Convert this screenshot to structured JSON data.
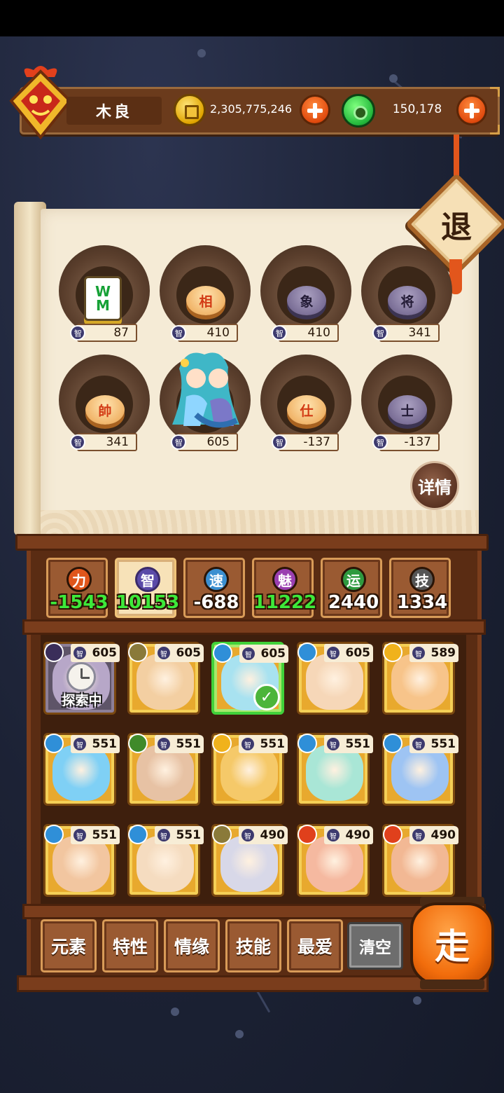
{
  "header": {
    "player_name": "木良",
    "gold": "2,305,775,246",
    "jade": "150,178",
    "avatar_icon": "demon-mask-icon",
    "gold_icon": "gold-coin-icon",
    "jade_icon": "jade-coin-icon"
  },
  "exit_label": "退",
  "details_label": "详情",
  "formation": {
    "stat_symbol": "智",
    "slots": [
      {
        "piece": "mahjong",
        "piece_text": "",
        "value": "87"
      },
      {
        "piece": "red-chess",
        "piece_text": "相",
        "value": "410"
      },
      {
        "piece": "purple-chess",
        "piece_text": "象",
        "value": "410"
      },
      {
        "piece": "purple-chess",
        "piece_text": "将",
        "value": "341"
      },
      {
        "piece": "red-chess",
        "piece_text": "帥",
        "value": "341"
      },
      {
        "piece": "hero",
        "piece_text": "",
        "value": "605"
      },
      {
        "piece": "red-chess",
        "piece_text": "仕",
        "value": "-137"
      },
      {
        "piece": "purple-chess",
        "piece_text": "士",
        "value": "-137"
      }
    ]
  },
  "attributes": [
    {
      "label": "力",
      "value": "-1543",
      "green": true,
      "active": false,
      "color": "#e0561c"
    },
    {
      "label": "智",
      "value": "10153",
      "green": true,
      "active": true,
      "color": "#5a4aa8"
    },
    {
      "label": "速",
      "value": "-688",
      "green": false,
      "active": false,
      "color": "#3b8fd0"
    },
    {
      "label": "魅",
      "value": "11222",
      "green": true,
      "active": false,
      "color": "#9a3fb0"
    },
    {
      "label": "运",
      "value": "2440",
      "green": false,
      "active": false,
      "color": "#2f9a3f"
    },
    {
      "label": "技",
      "value": "1334",
      "green": false,
      "active": false,
      "color": "#555555"
    }
  ],
  "heroes": [
    {
      "element": "dark",
      "value": "605",
      "status": "探索中",
      "state": "exploring"
    },
    {
      "element": "earth",
      "value": "605",
      "status": "",
      "state": "normal"
    },
    {
      "element": "water",
      "value": "605",
      "status": "",
      "state": "selected"
    },
    {
      "element": "water",
      "value": "605",
      "status": "",
      "state": "normal"
    },
    {
      "element": "light",
      "value": "589",
      "status": "",
      "state": "normal"
    },
    {
      "element": "water",
      "value": "551",
      "status": "",
      "state": "normal"
    },
    {
      "element": "wood",
      "value": "551",
      "status": "",
      "state": "normal"
    },
    {
      "element": "light",
      "value": "551",
      "status": "",
      "state": "normal"
    },
    {
      "element": "water",
      "value": "551",
      "status": "",
      "state": "normal"
    },
    {
      "element": "water",
      "value": "551",
      "status": "",
      "state": "normal"
    },
    {
      "element": "water",
      "value": "551",
      "status": "",
      "state": "normal"
    },
    {
      "element": "water",
      "value": "551",
      "status": "",
      "state": "normal"
    },
    {
      "element": "earth",
      "value": "490",
      "status": "",
      "state": "normal"
    },
    {
      "element": "fire",
      "value": "490",
      "status": "",
      "state": "normal"
    },
    {
      "element": "fire",
      "value": "490",
      "status": "",
      "state": "normal"
    }
  ],
  "filters": [
    "元素",
    "特性",
    "情缘",
    "技能",
    "最爱"
  ],
  "clear_label": "清空",
  "go_label": "走",
  "colors": {
    "water": "#2f8fd8",
    "earth": "#8a7a3a",
    "light": "#f0b21c",
    "wood": "#3f8a2a",
    "fire": "#e0401c",
    "dark": "#3a2e5a"
  }
}
